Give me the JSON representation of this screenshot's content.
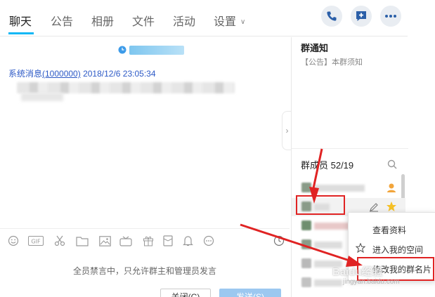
{
  "tabs": [
    {
      "label": "聊天"
    },
    {
      "label": "公告"
    },
    {
      "label": "相册"
    },
    {
      "label": "文件"
    },
    {
      "label": "活动"
    },
    {
      "label": "设置"
    }
  ],
  "header_icons": [
    "phone-icon",
    "add-message-icon",
    "more-icon"
  ],
  "chat": {
    "system_prefix": "系统消息",
    "system_id": "(1000000)",
    "system_time": "2018/12/6 23:05:34"
  },
  "notice": {
    "title": "群通知",
    "text": "【公告】本群须知"
  },
  "members": {
    "title": "群成员 52/19"
  },
  "input": {
    "mute_text": "全员禁言中，只允许群主和管理员发言",
    "close_label": "关闭(C)",
    "send_label": "发送(S)"
  },
  "context_menu": {
    "items": [
      {
        "label": "查看资料",
        "icon": ""
      },
      {
        "label": "进入我的空间",
        "icon": "star-icon"
      },
      {
        "label": "修改我的群名片",
        "icon": ""
      }
    ]
  },
  "watermark": {
    "text": "Baidu经验",
    "sub": "jingyan.baidu.com"
  },
  "colors": {
    "accent": "#12b7f5",
    "link": "#2c59c6",
    "highlight": "#e02323"
  }
}
